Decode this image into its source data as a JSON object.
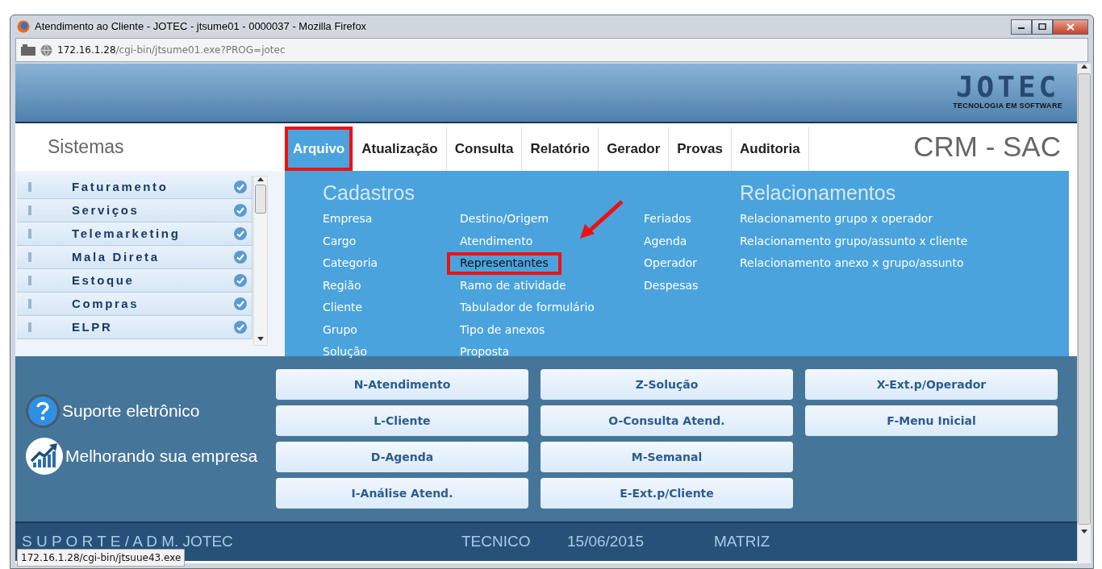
{
  "window": {
    "title": "Atendimento ao Cliente - JOTEC - jtsume01 - 0000037 - Mozilla Firefox"
  },
  "address_bar": {
    "host": "172.16.1.28",
    "path": "/cgi-bin/jtsume01.exe?PROG=jotec"
  },
  "header": {
    "logo": "JOTEC",
    "tagline": "TECNOLOGIA EM SOFTWARE"
  },
  "sidebar": {
    "title": "Sistemas",
    "items": [
      {
        "label": "Faturamento"
      },
      {
        "label": "Serviços"
      },
      {
        "label": "Telemarketing"
      },
      {
        "label": "Mala Direta"
      },
      {
        "label": "Estoque"
      },
      {
        "label": "Compras"
      },
      {
        "label": "ELPR"
      }
    ]
  },
  "menu": {
    "items": [
      {
        "label": "Arquivo",
        "selected": true,
        "highlighted": true
      },
      {
        "label": "Atualização",
        "selected": false,
        "highlighted": false
      },
      {
        "label": "Consulta",
        "selected": false,
        "highlighted": false
      },
      {
        "label": "Relatório",
        "selected": false,
        "highlighted": false
      },
      {
        "label": "Gerador",
        "selected": false,
        "highlighted": false
      },
      {
        "label": "Provas",
        "selected": false,
        "highlighted": false
      },
      {
        "label": "Auditoria",
        "selected": false,
        "highlighted": false
      }
    ],
    "app_title": "CRM - SAC"
  },
  "dropdown": {
    "sections": [
      {
        "title": "Cadastros",
        "columns": [
          [
            {
              "label": "Empresa",
              "highlighted": false
            },
            {
              "label": "Cargo",
              "highlighted": false
            },
            {
              "label": "Categoria",
              "highlighted": false
            },
            {
              "label": "Região",
              "highlighted": false
            },
            {
              "label": "Cliente",
              "highlighted": false
            },
            {
              "label": "Grupo",
              "highlighted": false
            },
            {
              "label": "Solução",
              "highlighted": false
            }
          ],
          [
            {
              "label": "Destino/Origem",
              "highlighted": false
            },
            {
              "label": "Atendimento",
              "highlighted": false
            },
            {
              "label": "Representantes",
              "highlighted": true
            },
            {
              "label": "Ramo de atividade",
              "highlighted": false
            },
            {
              "label": "Tabulador de formulário",
              "highlighted": false
            },
            {
              "label": "Tipo de anexos",
              "highlighted": false
            },
            {
              "label": "Proposta",
              "highlighted": false
            }
          ],
          [
            {
              "label": "Feriados",
              "highlighted": false
            },
            {
              "label": "Agenda",
              "highlighted": false
            },
            {
              "label": "Operador",
              "highlighted": false
            },
            {
              "label": "Despesas",
              "highlighted": false
            }
          ]
        ]
      },
      {
        "title": "Relacionamentos",
        "columns": [
          [
            {
              "label": "Relacionamento grupo x operador",
              "highlighted": false
            },
            {
              "label": "Relacionamento grupo/assunto x cliente",
              "highlighted": false
            },
            {
              "label": "Relacionamento anexo x grupo/assunto",
              "highlighted": false
            }
          ]
        ]
      }
    ]
  },
  "support_links": [
    {
      "kind": "help",
      "label": "Suporte eletrônico"
    },
    {
      "kind": "growth",
      "label": "Melhorando sua empresa"
    }
  ],
  "shortcut_buttons": [
    [
      "N-Atendimento",
      "Z-Solução",
      "X-Ext.p/Operador"
    ],
    [
      "L-Cliente",
      "O-Consulta Atend.",
      "F-Menu Inicial"
    ],
    [
      "D-Agenda",
      "M-Semanal"
    ],
    [
      "I-Análise Atend.",
      "E-Ext.p/Cliente"
    ]
  ],
  "status_bar": {
    "user": "S U P O R T E / A D M. JOTEC",
    "role": "TECNICO",
    "date": "15/06/2015",
    "branch": "MATRIZ"
  },
  "link_tooltip": "172.16.1.28/cgi-bin/jtsuue43.exe"
}
